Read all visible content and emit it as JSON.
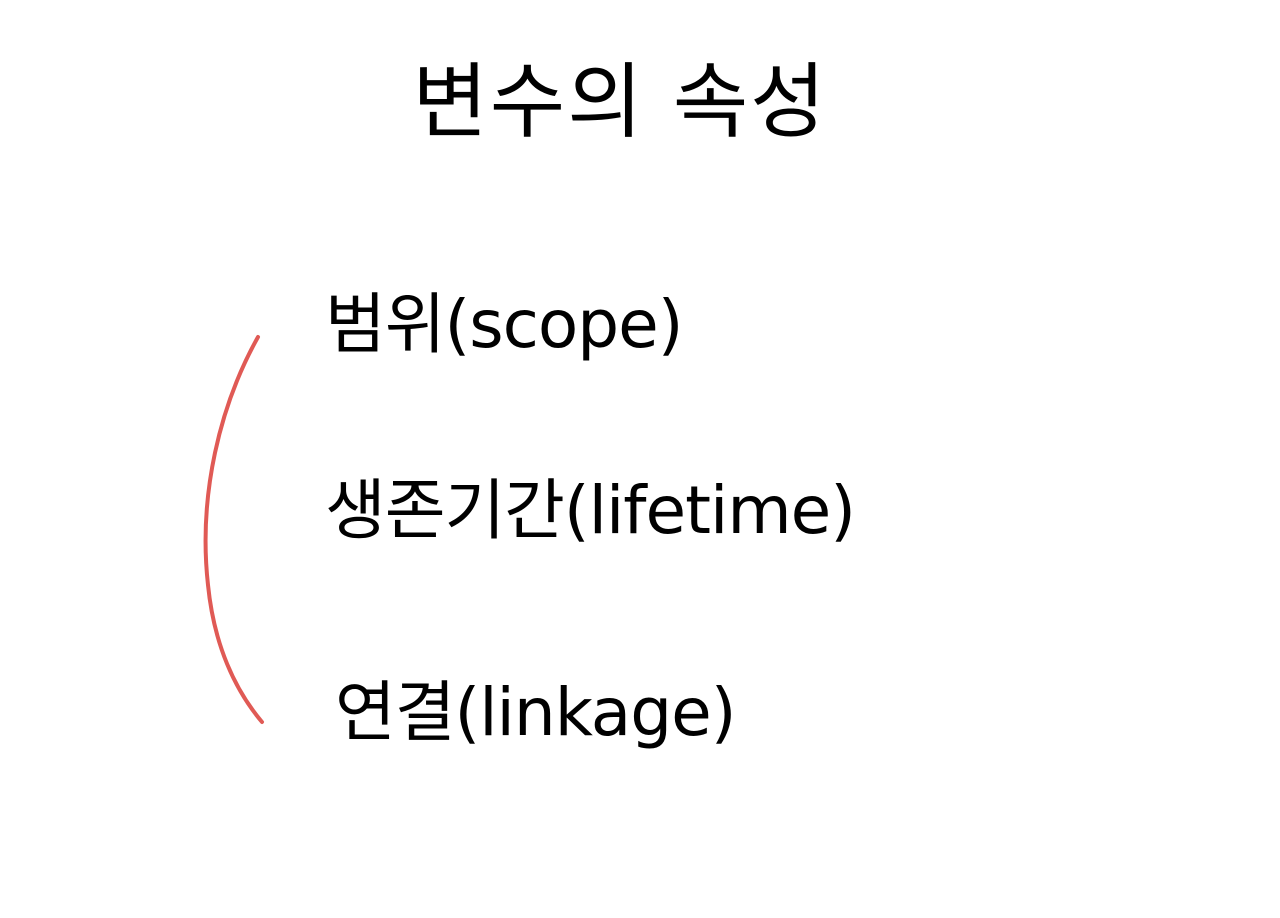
{
  "slide": {
    "title": "변수의 속성",
    "items": [
      {
        "label": "범위(scope)"
      },
      {
        "label": "생존기간(lifetime)"
      },
      {
        "label": "연결(linkage)"
      }
    ],
    "annotation": {
      "type": "hand-drawn-bracket",
      "color": "#e05a55"
    }
  }
}
